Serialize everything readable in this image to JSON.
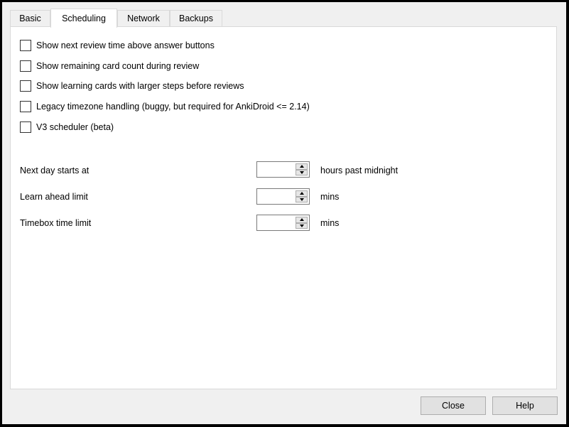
{
  "tabs": [
    {
      "label": "Basic"
    },
    {
      "label": "Scheduling"
    },
    {
      "label": "Network"
    },
    {
      "label": "Backups"
    }
  ],
  "active_tab": "Scheduling",
  "options": [
    {
      "label": "Show next review time above answer buttons",
      "checked": false
    },
    {
      "label": "Show remaining card count during review",
      "checked": false
    },
    {
      "label": "Show learning cards with larger steps before reviews",
      "checked": false
    },
    {
      "label": "Legacy timezone handling (buggy, but required for AnkiDroid <= 2.14)",
      "checked": false
    },
    {
      "label": "V3 scheduler (beta)",
      "checked": false
    }
  ],
  "fields": [
    {
      "label": "Next day starts at",
      "value": "",
      "unit": "hours past midnight"
    },
    {
      "label": "Learn ahead limit",
      "value": "",
      "unit": "mins"
    },
    {
      "label": "Timebox time limit",
      "value": "",
      "unit": "mins"
    }
  ],
  "buttons": {
    "close_label": "Close",
    "help_label": "Help"
  }
}
